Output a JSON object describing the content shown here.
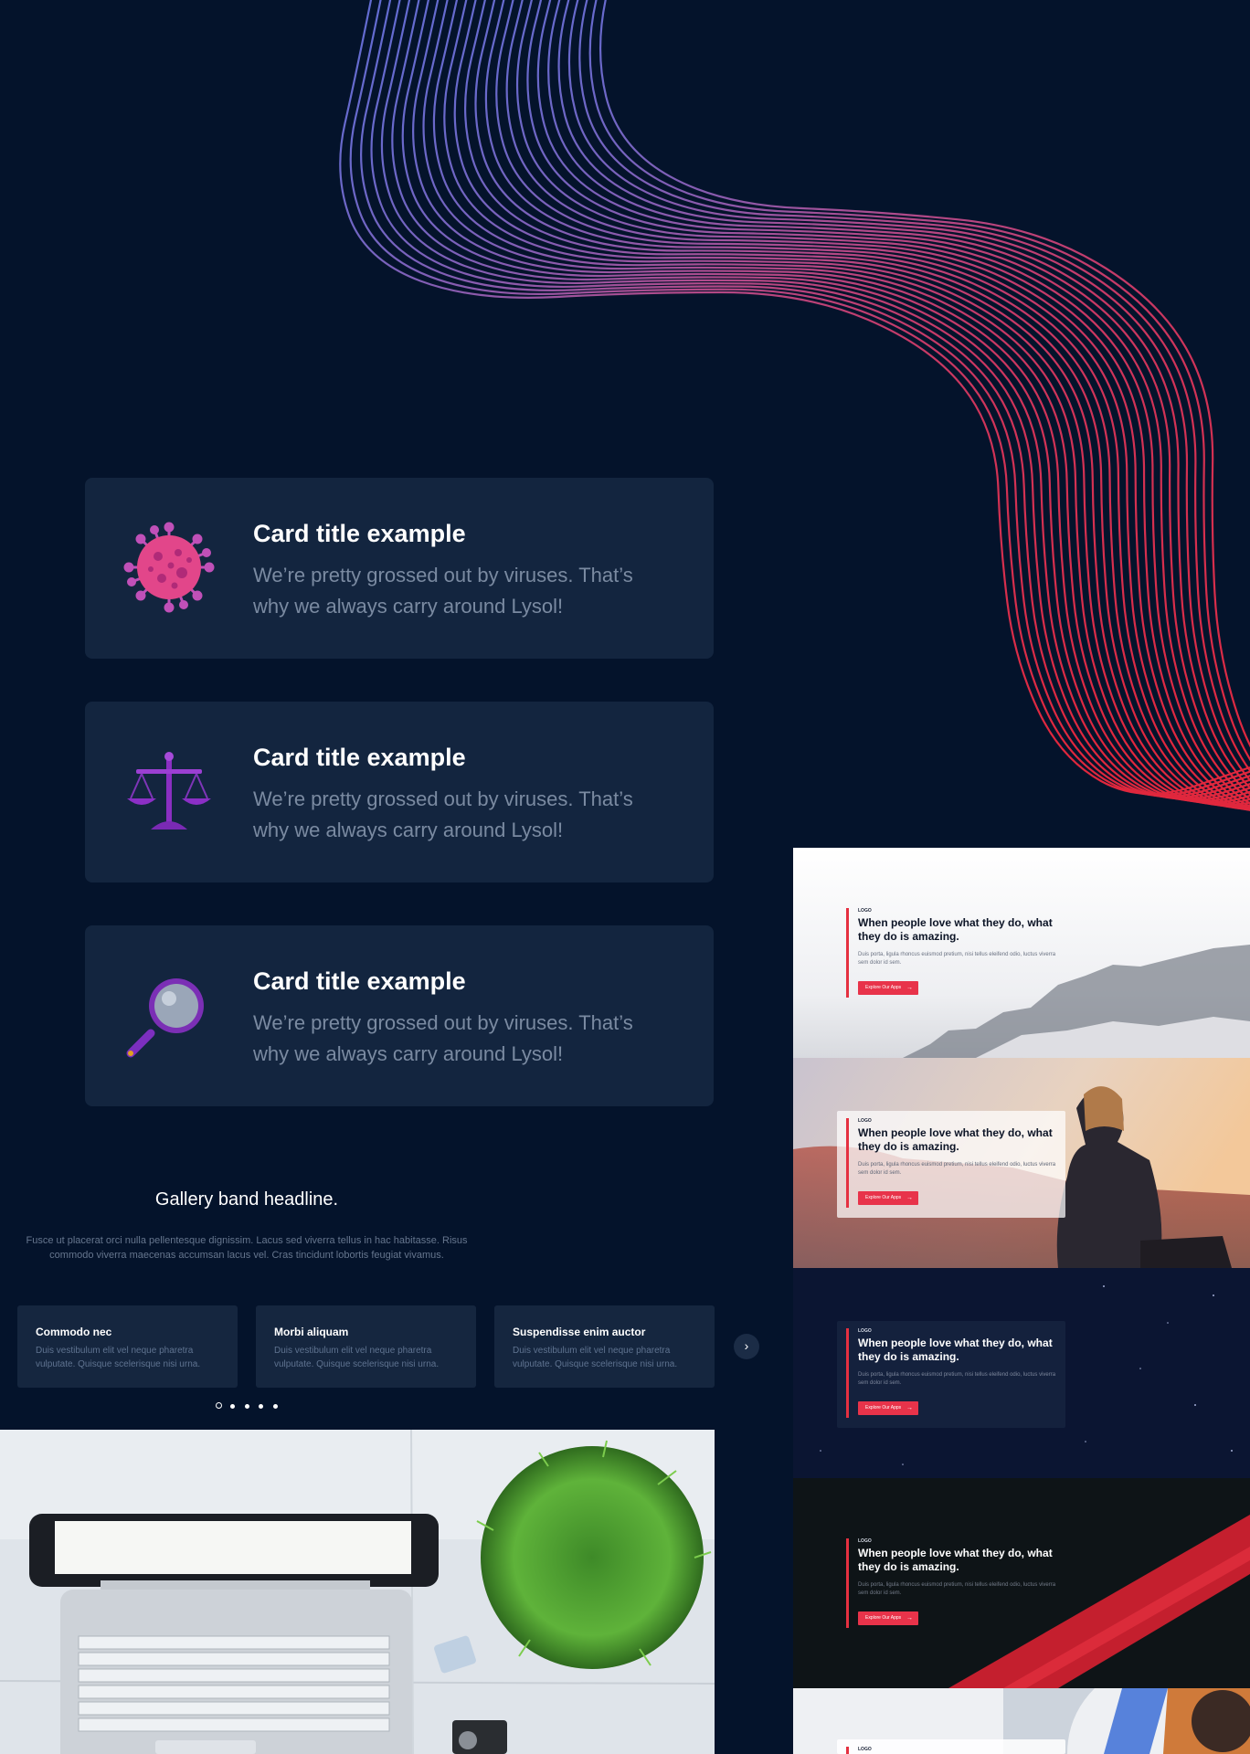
{
  "colors": {
    "page_bg": "#04132b",
    "card_bg": "#13253f",
    "accent": "#e8334a",
    "wave_start": "#5b6fd8",
    "wave_end": "#e0273d"
  },
  "cards": [
    {
      "title": "Card title example",
      "description": "We’re pretty grossed out by viruses. That’s why we always carry around Lysol!",
      "icon": "virus-icon"
    },
    {
      "title": "Card title example",
      "description": "We’re pretty grossed out by viruses. That’s why we always carry around Lysol!",
      "icon": "scales-icon"
    },
    {
      "title": "Card title example",
      "description": "We’re pretty grossed out by viruses. That’s why we always carry around Lysol!",
      "icon": "magnifier-icon"
    }
  ],
  "gallery": {
    "headline": "Gallery band headline.",
    "subtext": "Fusce ut placerat orci nulla pellentesque dignissim. Lacus sed viverra tellus in hac habitasse. Risus commodo viverra maecenas accumsan lacus vel. Cras tincidunt lobortis feugiat vivamus.",
    "items": [
      {
        "title": "Commodo nec",
        "text": "Duis vestibulum elit vel neque pharetra vulputate. Quisque scelerisque nisi urna."
      },
      {
        "title": "Morbi aliquam",
        "text": "Duis vestibulum elit vel neque pharetra vulputate. Quisque scelerisque nisi urna."
      },
      {
        "title": "Suspendisse enim auctor",
        "text": "Duis vestibulum elit vel neque pharetra vulputate. Quisque scelerisque nisi urna."
      }
    ],
    "next_icon": "chevron-right-icon",
    "dots_count": 5,
    "active_dot": 0
  },
  "hero_slides": [
    {
      "eyebrow": "LOGO",
      "title": "When people love what they do, what they do is amazing.",
      "body": "Duis porta, ligula rhoncus euismod pretium, nisi tellus eleifend odio, luctus viverra sem dolor id sem.",
      "button": "Explore Our Apps",
      "theme": "fog"
    },
    {
      "eyebrow": "LOGO",
      "title": "When people love what they do, what they do is amazing.",
      "body": "Duis porta, ligula rhoncus euismod pretium, nisi tellus eleifend odio, luctus viverra sem dolor id sem.",
      "button": "Explore Our Apps",
      "theme": "sunset"
    },
    {
      "eyebrow": "LOGO",
      "title": "When people love what they do, what they do is amazing.",
      "body": "Duis porta, ligula rhoncus euismod pretium, nisi tellus eleifend odio, luctus viverra sem dolor id sem.",
      "button": "Explore Our Apps",
      "theme": "night"
    },
    {
      "eyebrow": "LOGO",
      "title": "When people love what they do, what they do is amazing.",
      "body": "Duis porta, ligula rhoncus euismod pretium, nisi tellus eleifend odio, luctus viverra sem dolor id sem.",
      "button": "Explore Our Apps",
      "theme": "dark-red"
    },
    {
      "eyebrow": "LOGO",
      "theme": "office"
    }
  ]
}
